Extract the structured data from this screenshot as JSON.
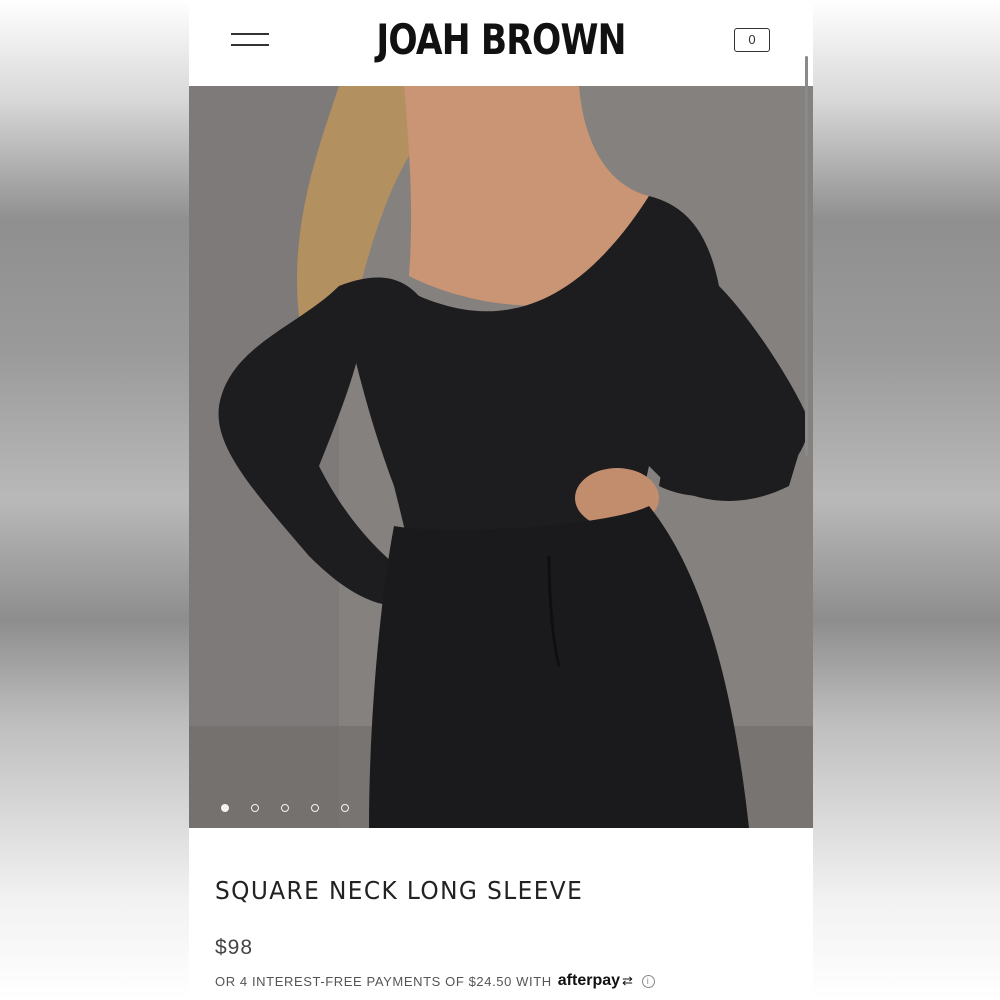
{
  "header": {
    "brand": "JOAH BROWN",
    "cart_count": "0"
  },
  "hero": {
    "image_alt": "Model wearing black square neck long sleeve bodysuit",
    "carousel_total": 5,
    "carousel_active": 1
  },
  "product": {
    "title": "SQUARE NECK LONG SLEEVE",
    "price": "$98",
    "installments_text": "OR 4 INTEREST-FREE PAYMENTS OF $24.50 WITH",
    "afterpay_label": "afterpay",
    "info_glyph": "i"
  },
  "colors": {
    "text": "#222222",
    "background": "#ffffff",
    "garment": "#1c1b1d"
  },
  "icons": {
    "menu": "hamburger-icon",
    "cart": "cart-icon",
    "info": "info-icon",
    "afterpay": "afterpay-icon"
  }
}
